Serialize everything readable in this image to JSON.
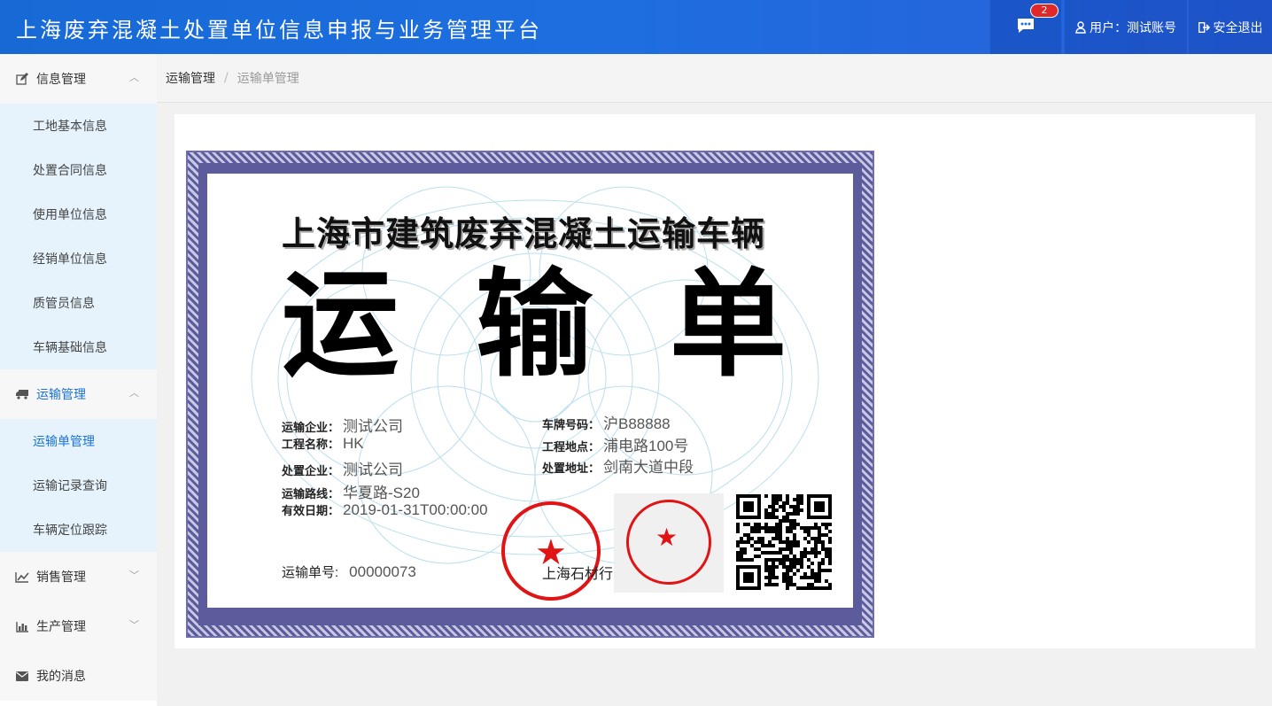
{
  "header": {
    "title": "上海废弃混凝土处置单位信息申报与业务管理平台",
    "message_count": "2",
    "user_label": "用户：测试账号",
    "logout_label": "安全退出"
  },
  "sidebar": {
    "groups": [
      {
        "label": "信息管理",
        "icon": "edit-icon",
        "expanded": true,
        "items": [
          "工地基本信息",
          "处置合同信息",
          "使用单位信息",
          "经销单位信息",
          "质管员信息",
          "车辆基础信息"
        ]
      },
      {
        "label": "运输管理",
        "icon": "truck-icon",
        "expanded": true,
        "active": true,
        "items": [
          "运输单管理",
          "运输记录查询",
          "车辆定位跟踪"
        ],
        "active_item": "运输单管理"
      },
      {
        "label": "销售管理",
        "icon": "line-chart-icon",
        "expanded": false
      },
      {
        "label": "生产管理",
        "icon": "bar-chart-icon",
        "expanded": false
      },
      {
        "label": "我的消息",
        "icon": "envelope-icon"
      }
    ]
  },
  "breadcrumb": {
    "parent": "运输管理",
    "separator": "/",
    "current": "运输单管理"
  },
  "certificate": {
    "subtitle": "上海市建筑废弃混凝土运输车辆",
    "title_chars": [
      "运",
      "输",
      "单"
    ],
    "fields": {
      "company": {
        "label": "运输企业：",
        "value": "测试公司"
      },
      "project": {
        "label": "工程名称：",
        "value": "HK"
      },
      "disposal": {
        "label": "处置企业：",
        "value": "测试公司"
      },
      "route": {
        "label": "运输路线：",
        "value": "华夏路-S20"
      },
      "valid": {
        "label": "有效日期：",
        "value": "2019-01-31T00:00:00"
      },
      "plate": {
        "label": "车牌号码：",
        "value": "沪B88888"
      },
      "site": {
        "label": "工程地点：",
        "value": "浦电路100号"
      },
      "address": {
        "label": "处置地址：",
        "value": "剑南大道中段"
      },
      "number": {
        "label": "运输单号:",
        "value": "00000073"
      }
    },
    "seal_text": "上海石材行"
  },
  "colors": {
    "header_blue": "#1d6fe0",
    "accent": "#1a73d9",
    "seal_red": "#e01414",
    "border_purple": "#5c5c9c"
  }
}
